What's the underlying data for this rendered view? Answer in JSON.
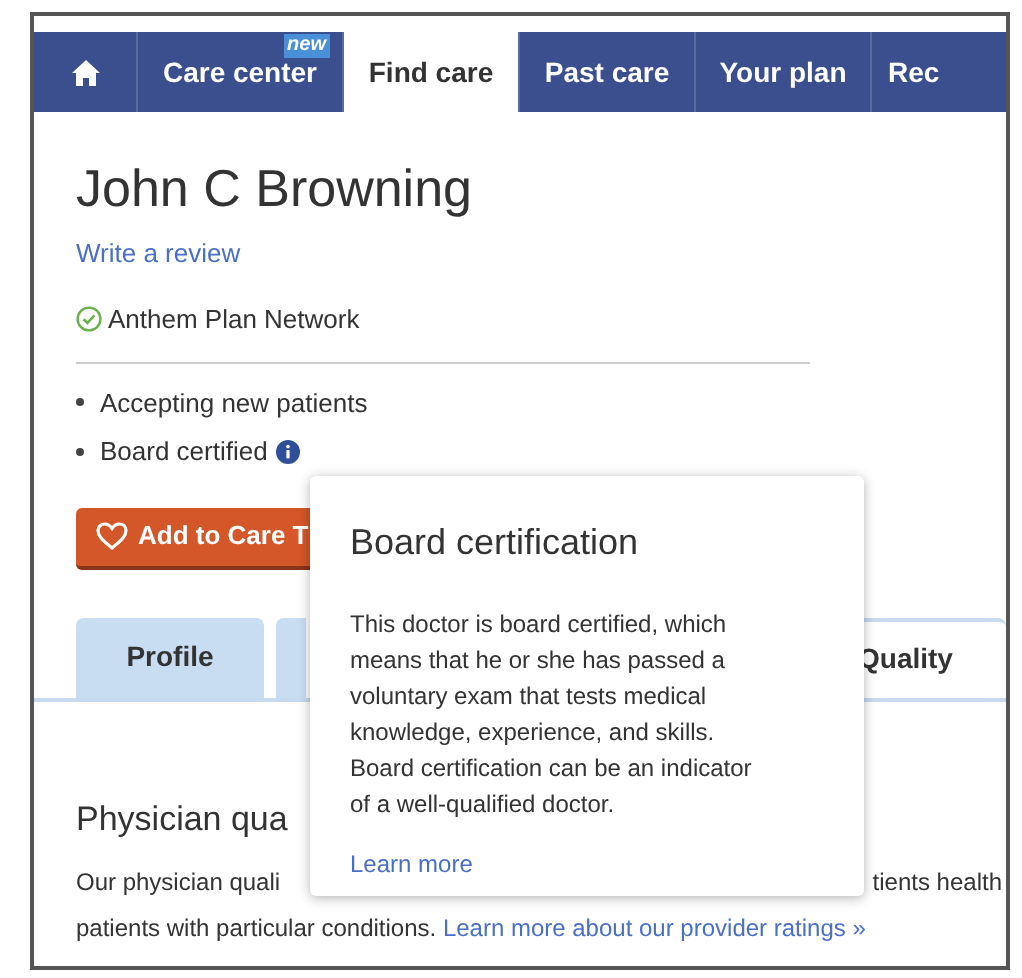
{
  "nav": {
    "tabs": [
      {
        "kind": "home",
        "selected": false
      },
      {
        "kind": "text",
        "label": "Care center",
        "badge": "new",
        "selected": false
      },
      {
        "kind": "text",
        "label": "Find care",
        "selected": true
      },
      {
        "kind": "text",
        "label": "Past care",
        "selected": false
      },
      {
        "kind": "text",
        "label": "Your plan",
        "selected": false
      },
      {
        "kind": "text",
        "label": "Rec",
        "selected": false
      }
    ]
  },
  "provider": {
    "name": "John C Browning",
    "review_link": "Write a review",
    "network": "Anthem Plan Network",
    "network_verified": true,
    "facts": [
      {
        "text": "Accepting new patients",
        "info": false
      },
      {
        "text": "Board certified",
        "info": true
      }
    ],
    "button": "Add to Care T"
  },
  "tabs": [
    {
      "label": "Profile",
      "selected": false
    },
    {
      "selected": false
    },
    {
      "label": "Quality",
      "selected": true
    }
  ],
  "section": {
    "title": "Physician qua",
    "line_1_left": "Our physician quali",
    "line_1_right": "tients health",
    "line_2": "patients with particular conditions.",
    "line_2_link": "Learn more about our provider ratings »"
  },
  "tooltip": {
    "title": "Board certification",
    "body": "This doctor is board certified, which means that he or she has passed a voluntary exam that tests medical knowledge, experience, and skills. Board certification can be an indicator of a well-qualified doctor.",
    "link": "Learn more"
  }
}
